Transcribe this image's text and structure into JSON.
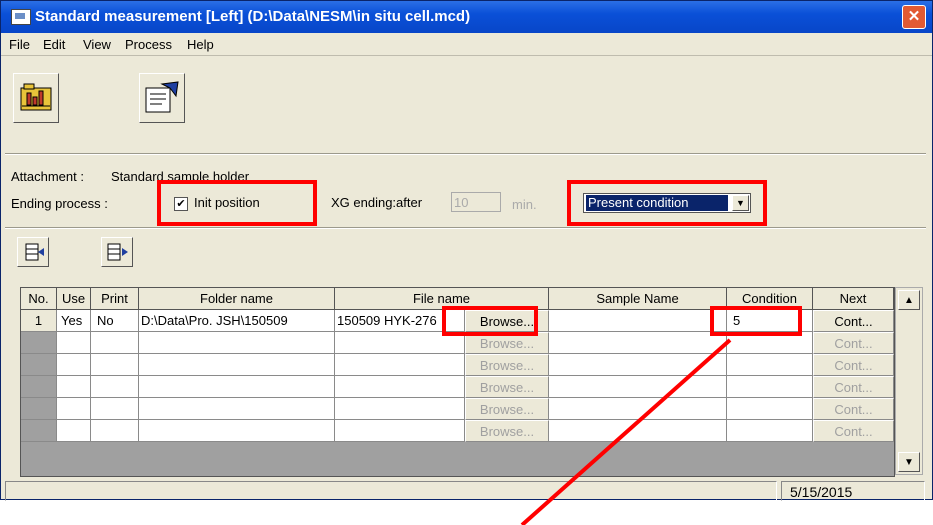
{
  "window": {
    "title": "Standard measurement [Left] (D:\\Data\\NESM\\in situ cell.mcd)",
    "close_glyph": "✕"
  },
  "menu": [
    "File",
    "Edit",
    "View",
    "Process",
    "Help"
  ],
  "toolbar": {
    "icons": [
      "folder-chart-icon",
      "document-edit-icon"
    ]
  },
  "info": {
    "attachment_label": "Attachment :",
    "attachment_value": "Standard sample holder",
    "ending_label": "Ending process :",
    "init_position_label": "Init position",
    "init_position_checked": true,
    "xg_label": "XG ending:after",
    "xg_value": "10",
    "xg_unit": "min.",
    "condition_select": "Present condition"
  },
  "table": {
    "headers": [
      "No.",
      "Use",
      "Print",
      "Folder name",
      "File name",
      "Sample Name",
      "Condition",
      "Next"
    ],
    "rows": [
      {
        "no": "1",
        "use": "Yes",
        "print": "No",
        "folder": "D:\\Data\\Pro. JSH\\150509",
        "file": "150509 HYK-276",
        "browse": "Browse...",
        "sample": "",
        "condition": "5",
        "next": "Cont..."
      },
      {
        "no": "",
        "use": "",
        "print": "",
        "folder": "",
        "file": "",
        "browse": "Browse...",
        "sample": "",
        "condition": "",
        "next": "Cont..."
      },
      {
        "no": "",
        "use": "",
        "print": "",
        "folder": "",
        "file": "",
        "browse": "Browse...",
        "sample": "",
        "condition": "",
        "next": "Cont..."
      },
      {
        "no": "",
        "use": "",
        "print": "",
        "folder": "",
        "file": "",
        "browse": "Browse...",
        "sample": "",
        "condition": "",
        "next": "Cont..."
      },
      {
        "no": "",
        "use": "",
        "print": "",
        "folder": "",
        "file": "",
        "browse": "Browse...",
        "sample": "",
        "condition": "",
        "next": "Cont..."
      },
      {
        "no": "",
        "use": "",
        "print": "",
        "folder": "",
        "file": "",
        "browse": "Browse...",
        "sample": "",
        "condition": "",
        "next": "Cont..."
      }
    ]
  },
  "status": {
    "date": "5/15/2015"
  },
  "colors": {
    "highlight": "#ff0000",
    "title_bar": "#0a50d8",
    "selection": "#0a246a"
  }
}
